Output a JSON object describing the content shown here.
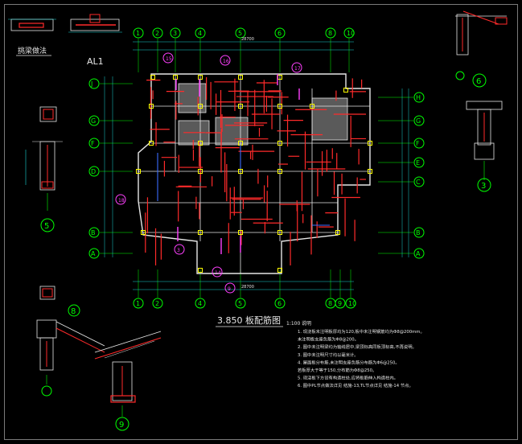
{
  "drawing": {
    "top_left_title": "挑梁做法",
    "al_label": "AL1",
    "plan_title": "3.850  板配筋图",
    "plan_scale": "1:100",
    "notes_label": "说明",
    "notes": [
      "1. 现浇板未注明板厚均为120,板中未注明钢筋均为Φ8@200mm。",
      "   未注明板支座负筋为Φ8@200。",
      "2. 图中未注明梁均为轴线居中,梁顶标高同板顶标高,不再说明。",
      "3. 图中未注明尺寸均以毫米计。",
      "4. 屋面板分布筋,未注明支座负筋分布筋为Φ6@250。",
      "   若板厚大于等于150,分布筋为Φ8@250。",
      "5. 现浇板下方设有构造柱处,应将板筋伸入构造柱内。",
      "6. 图中PL节点做法详见 结施-13,TL节点详见 结施-14 节点。"
    ],
    "axis_top": [
      "1",
      "2",
      "3",
      "4",
      "5",
      "6",
      "8",
      "10"
    ],
    "axis_bottom": [
      "1",
      "2",
      "4",
      "5",
      "6",
      "8",
      "9",
      "10"
    ],
    "axis_left": [
      "J",
      "G",
      "F",
      "D",
      "B",
      "A"
    ],
    "axis_right": [
      "H",
      "G",
      "F",
      "E",
      "C",
      "B",
      "A"
    ],
    "section_marks": [
      "5",
      "8",
      "9",
      "3",
      "6"
    ],
    "magenta_tags": [
      "15",
      "16",
      "17",
      "18",
      "3",
      "14",
      "9"
    ],
    "top_dimension": "28700",
    "bottom_dimension": "28700"
  },
  "colors": {
    "background": "#000000",
    "axis_green": "#00ff00",
    "rebar_red": "#ff2a2a",
    "wall_white": "#e6e6e6",
    "dim_cyan": "#19d3d3",
    "tag_magenta": "#ff40ff",
    "yellow": "#ffff00",
    "blue": "#3b6cff"
  }
}
